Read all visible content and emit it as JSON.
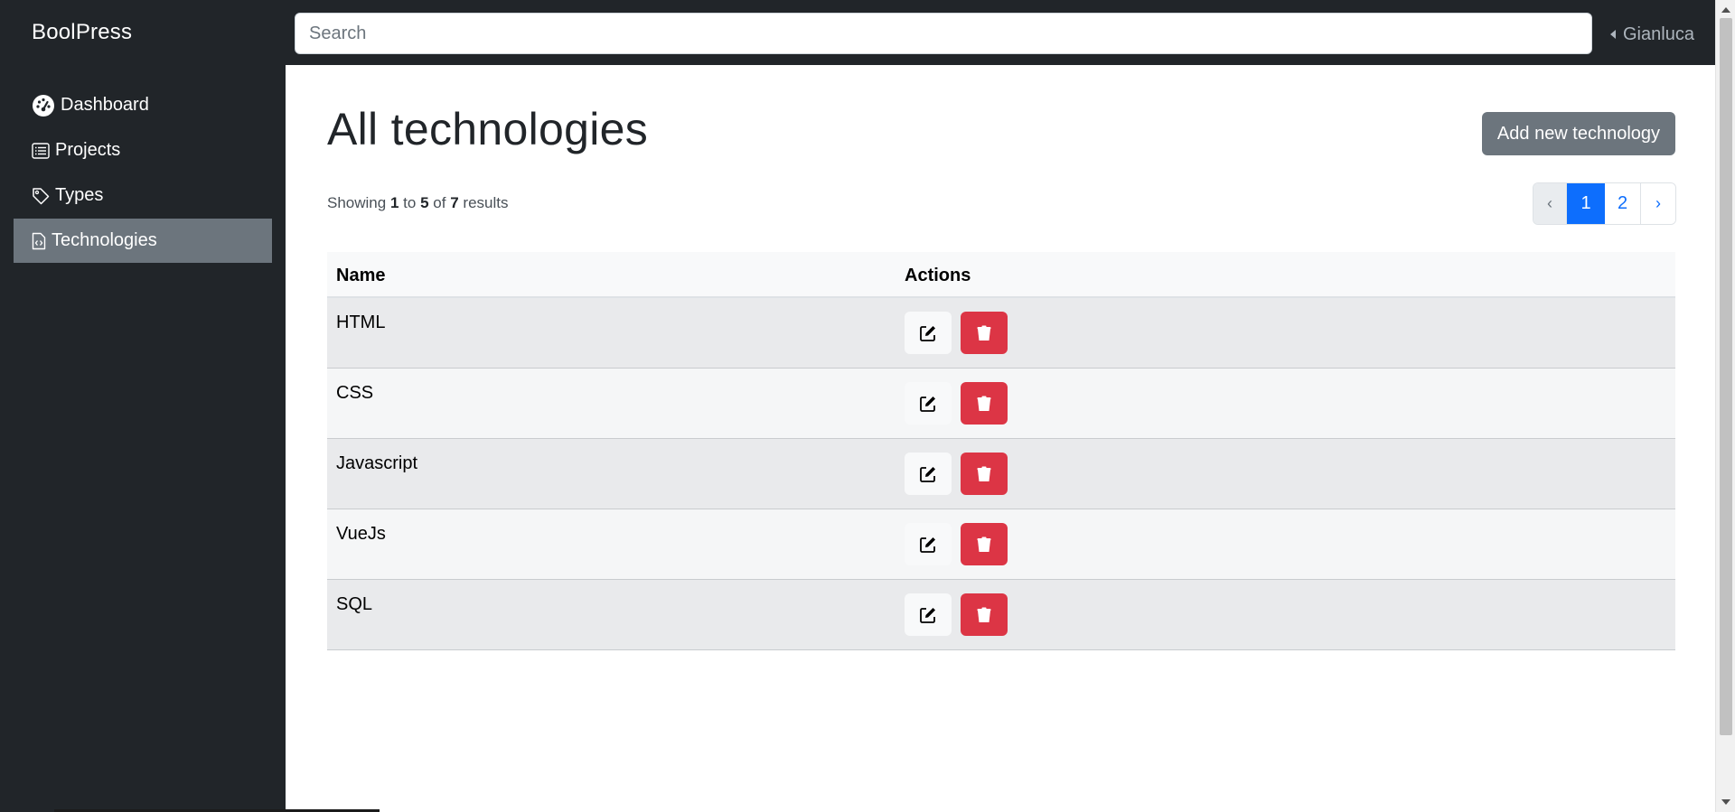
{
  "navbar": {
    "brand": "BoolPress",
    "search_placeholder": "Search",
    "user_name": "Gianluca"
  },
  "sidebar": {
    "items": [
      {
        "label": "Dashboard",
        "icon": "dashboard-gauge-icon",
        "active": false
      },
      {
        "label": "Projects",
        "icon": "list-icon",
        "active": false
      },
      {
        "label": "Types",
        "icon": "tag-icon",
        "active": false
      },
      {
        "label": "Technologies",
        "icon": "code-file-icon",
        "active": true
      }
    ]
  },
  "main": {
    "title": "All technologies",
    "add_button": "Add new technology",
    "results": {
      "prefix": "Showing",
      "from": "1",
      "to_word": "to",
      "to": "5",
      "of_word": "of",
      "total": "7",
      "suffix": "results"
    },
    "pagination": {
      "prev": "‹",
      "pages": [
        "1",
        "2"
      ],
      "current": "1",
      "next": "›"
    },
    "table": {
      "headers": [
        "Name",
        "Actions"
      ],
      "rows": [
        {
          "name": "HTML"
        },
        {
          "name": "CSS"
        },
        {
          "name": "Javascript"
        },
        {
          "name": "VueJs"
        },
        {
          "name": "SQL"
        }
      ]
    }
  },
  "colors": {
    "navbar_bg": "#212529",
    "active_sidebar": "#6c757d",
    "primary": "#0d6efd",
    "danger": "#dc3545",
    "secondary": "#6c757d"
  }
}
